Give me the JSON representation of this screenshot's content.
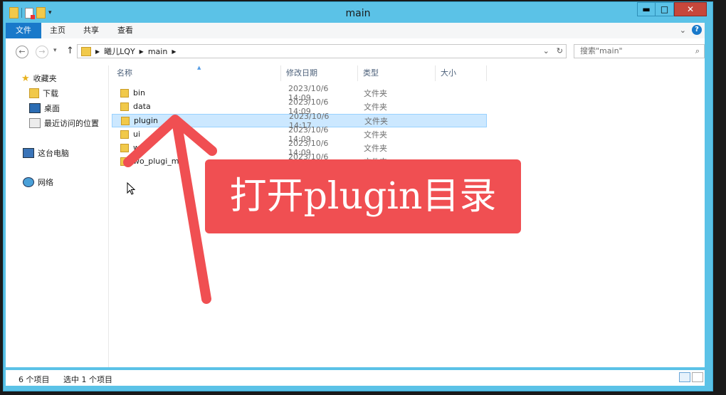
{
  "window": {
    "title": "main",
    "minimize": "▬",
    "maximize": "□",
    "close": "✕"
  },
  "quick_access": {
    "dropdown": "▾"
  },
  "ribbon": {
    "tabs": [
      "文件",
      "主页",
      "共享",
      "查看"
    ],
    "expand": "⌄",
    "help": "?"
  },
  "address": {
    "back": "←",
    "forward": "→",
    "recent": "▾",
    "up": "↑",
    "crumbs": [
      "曦儿LQY",
      "main"
    ],
    "separator": "▶",
    "dropdown": "⌄",
    "refresh": "↻"
  },
  "search": {
    "placeholder": "搜索\"main\"",
    "icon": "⌕"
  },
  "nav": {
    "favorites": "收藏夹",
    "downloads": "下载",
    "desktop": "桌面",
    "recent": "最近访问的位置",
    "this_pc": "这台电脑",
    "network": "网络"
  },
  "columns": {
    "name": "名称",
    "date": "修改日期",
    "type": "类型",
    "size": "大小"
  },
  "files": [
    {
      "name": "bin",
      "date": "2023/10/6 14:09",
      "type": "文件夹",
      "selected": false
    },
    {
      "name": "data",
      "date": "2023/10/6 14:09",
      "type": "文件夹",
      "selected": false
    },
    {
      "name": "plugin",
      "date": "2023/10/6 14:17",
      "type": "文件夹",
      "selected": true
    },
    {
      "name": "ui",
      "date": "2023/10/6 14:09",
      "type": "文件夹",
      "selected": false
    },
    {
      "name": "wke",
      "date": "2023/10/6 14:09",
      "type": "文件夹",
      "selected": false
    },
    {
      "name": "wo_plugi_mp",
      "date": "2023/10/6 14:09",
      "type": "文件夹",
      "selected": false
    }
  ],
  "status": {
    "count": "6 个项目",
    "selected": "选中 1 个项目"
  },
  "annotation": {
    "text": "打开plugin目录",
    "color": "#f04f52"
  }
}
